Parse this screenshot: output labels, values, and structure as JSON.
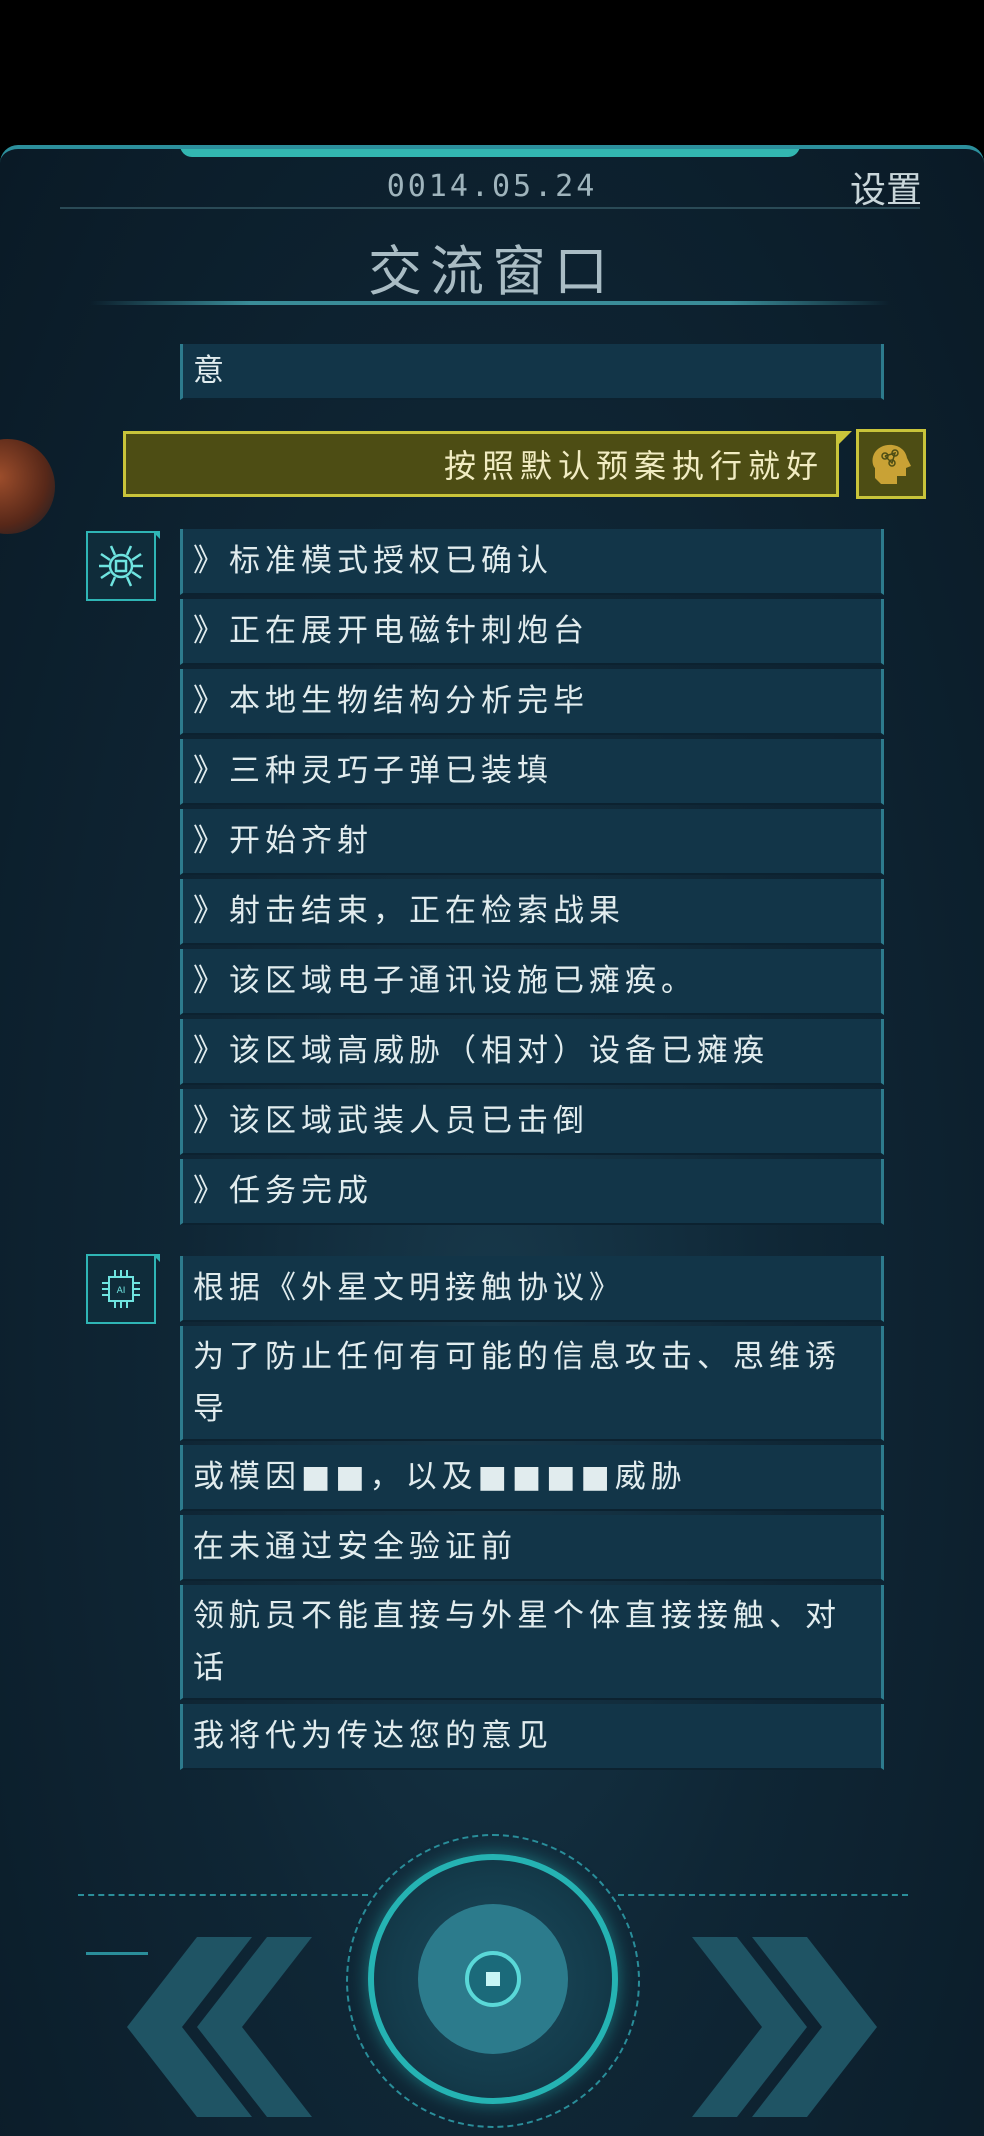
{
  "header": {
    "date": "0014.05.24",
    "settings_label": "设置",
    "title": "交流窗口"
  },
  "partial_message": "意",
  "user_message": "按照默认预案执行就好",
  "group1": [
    "》标准模式授权已确认",
    "》正在展开电磁针刺炮台",
    "》本地生物结构分析完毕",
    "》三种灵巧子弹已装填",
    "》开始齐射",
    "》射击结束，正在检索战果",
    "》该区域电子通讯设施已瘫痪。",
    "》该区域高威胁（相对）设备已瘫痪",
    "》该区域武装人员已击倒",
    "》任务完成"
  ],
  "group2": [
    "根据《外星文明接触协议》",
    "为了防止任何有可能的信息攻击、思维诱导",
    "或模因■■，以及■■■■威胁",
    "在未通过安全验证前",
    "领航员不能直接与外星个体直接接触、对话",
    "我将代为传达您的意见"
  ],
  "colors": {
    "accent": "#3ad1c8",
    "user_bubble": "#4d4d14",
    "user_border": "#c9c43a",
    "bot_bubble": "#123548"
  },
  "icons": {
    "bot1": "spider-bot-icon",
    "bot2": "ai-chip-icon",
    "user": "brain-head-icon",
    "nav_back": "double-chevron-left-icon",
    "nav_forward": "double-chevron-right-icon"
  }
}
